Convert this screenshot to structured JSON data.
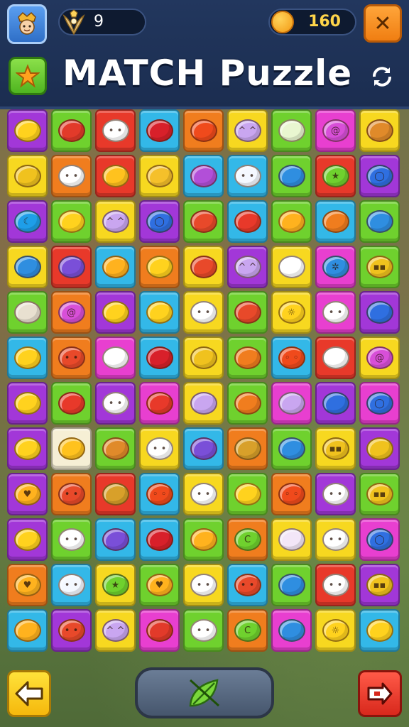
{
  "header": {
    "title": "MATCH Puzzle",
    "level": "9",
    "coins": "160"
  },
  "icons": {
    "avatar": "hero-avatar-icon",
    "level_emblem": "winged-emblem-icon",
    "coin": "coin-icon",
    "close": "close-icon",
    "star": "star-icon",
    "refresh": "refresh-icon",
    "back": "back-arrow-icon",
    "hint": "leaf-hint-icon",
    "exit": "exit-icon"
  },
  "colors": {
    "purple": "#a237d8",
    "green": "#6fd12e",
    "red": "#e8392a",
    "cyan": "#33b8e8",
    "orange": "#f07d1e",
    "yellow": "#f7d820",
    "pink": "#e83fd0",
    "cream": "#f6efd5"
  },
  "board": {
    "columns": 9,
    "rows": [
      [
        "purple",
        "green",
        "red",
        "cyan",
        "orange",
        "yellow",
        "green",
        "pink",
        "yellow"
      ],
      [
        "yellow",
        "orange",
        "red",
        "yellow",
        "cyan",
        "cyan",
        "green",
        "red",
        "purple"
      ],
      [
        "purple",
        "green",
        "yellow",
        "purple",
        "green",
        "cyan",
        "green",
        "cyan",
        "green"
      ],
      [
        "yellow",
        "red",
        "cyan",
        "orange",
        "yellow",
        "purple",
        "yellow",
        "pink",
        "green"
      ],
      [
        "green",
        "orange",
        "purple",
        "cyan",
        "yellow",
        "green",
        "yellow",
        "pink",
        "purple"
      ],
      [
        "cyan",
        "orange",
        "pink",
        "cyan",
        "yellow",
        "green",
        "cyan",
        "red",
        "yellow"
      ],
      [
        "purple",
        "green",
        "purple",
        "pink",
        "yellow",
        "green",
        "pink",
        "purple",
        "pink"
      ],
      [
        "purple",
        "cream",
        "green",
        "yellow",
        "cyan",
        "orange",
        "green",
        "yellow",
        "purple"
      ],
      [
        "purple",
        "orange",
        "red",
        "cyan",
        "yellow",
        "green",
        "orange",
        "purple",
        "green"
      ],
      [
        "purple",
        "green",
        "cyan",
        "cyan",
        "green",
        "orange",
        "yellow",
        "yellow",
        "pink"
      ],
      [
        "orange",
        "cyan",
        "yellow",
        "green",
        "yellow",
        "cyan",
        "green",
        "red",
        "purple"
      ],
      [
        "cyan",
        "purple",
        "yellow",
        "pink",
        "green",
        "orange",
        "pink",
        "yellow",
        "cyan"
      ]
    ],
    "pieces": [
      [
        "lemon",
        "apple",
        "face",
        "cherry",
        "tomato",
        "cat",
        "tulip",
        "swirl",
        "donut"
      ],
      [
        "leaf",
        "face",
        "feather",
        "blob",
        "lens",
        "ghost",
        "drop",
        "star",
        "ring"
      ],
      [
        "moon",
        "bubble",
        "cat",
        "ring",
        "pepper",
        "melon",
        "bird",
        "bell",
        "drop"
      ],
      [
        "drop",
        "plum",
        "bird",
        "bubble",
        "dome",
        "cat",
        "shell",
        "gear",
        "robot"
      ],
      [
        "cake",
        "swirl",
        "block",
        "lemon",
        "face",
        "ball",
        "sun",
        "face",
        "cone"
      ],
      [
        "lemon",
        "berry",
        "bowl",
        "cherry",
        "leaf",
        "spin",
        "crab",
        "bowl",
        "swirl"
      ],
      [
        "lemon",
        "house",
        "face",
        "melon",
        "pencil",
        "nut",
        "candy",
        "cone",
        "ring"
      ],
      [
        "lemon",
        "feather",
        "donut",
        "face",
        "pill",
        "lolly",
        "drop",
        "robot",
        "leaf"
      ],
      [
        "heart",
        "berry",
        "lolly",
        "crab",
        "face",
        "cheese",
        "crab",
        "face",
        "robot"
      ],
      [
        "lemon",
        "face",
        "plum",
        "cherry",
        "bird",
        "coil",
        "egg",
        "face",
        "ring"
      ],
      [
        "heart",
        "ghost",
        "star",
        "heart",
        "face",
        "berry",
        "drop",
        "face",
        "robot"
      ],
      [
        "bird",
        "berry",
        "cat",
        "apple",
        "face",
        "coil",
        "drop",
        "sun",
        "lemon"
      ]
    ]
  }
}
